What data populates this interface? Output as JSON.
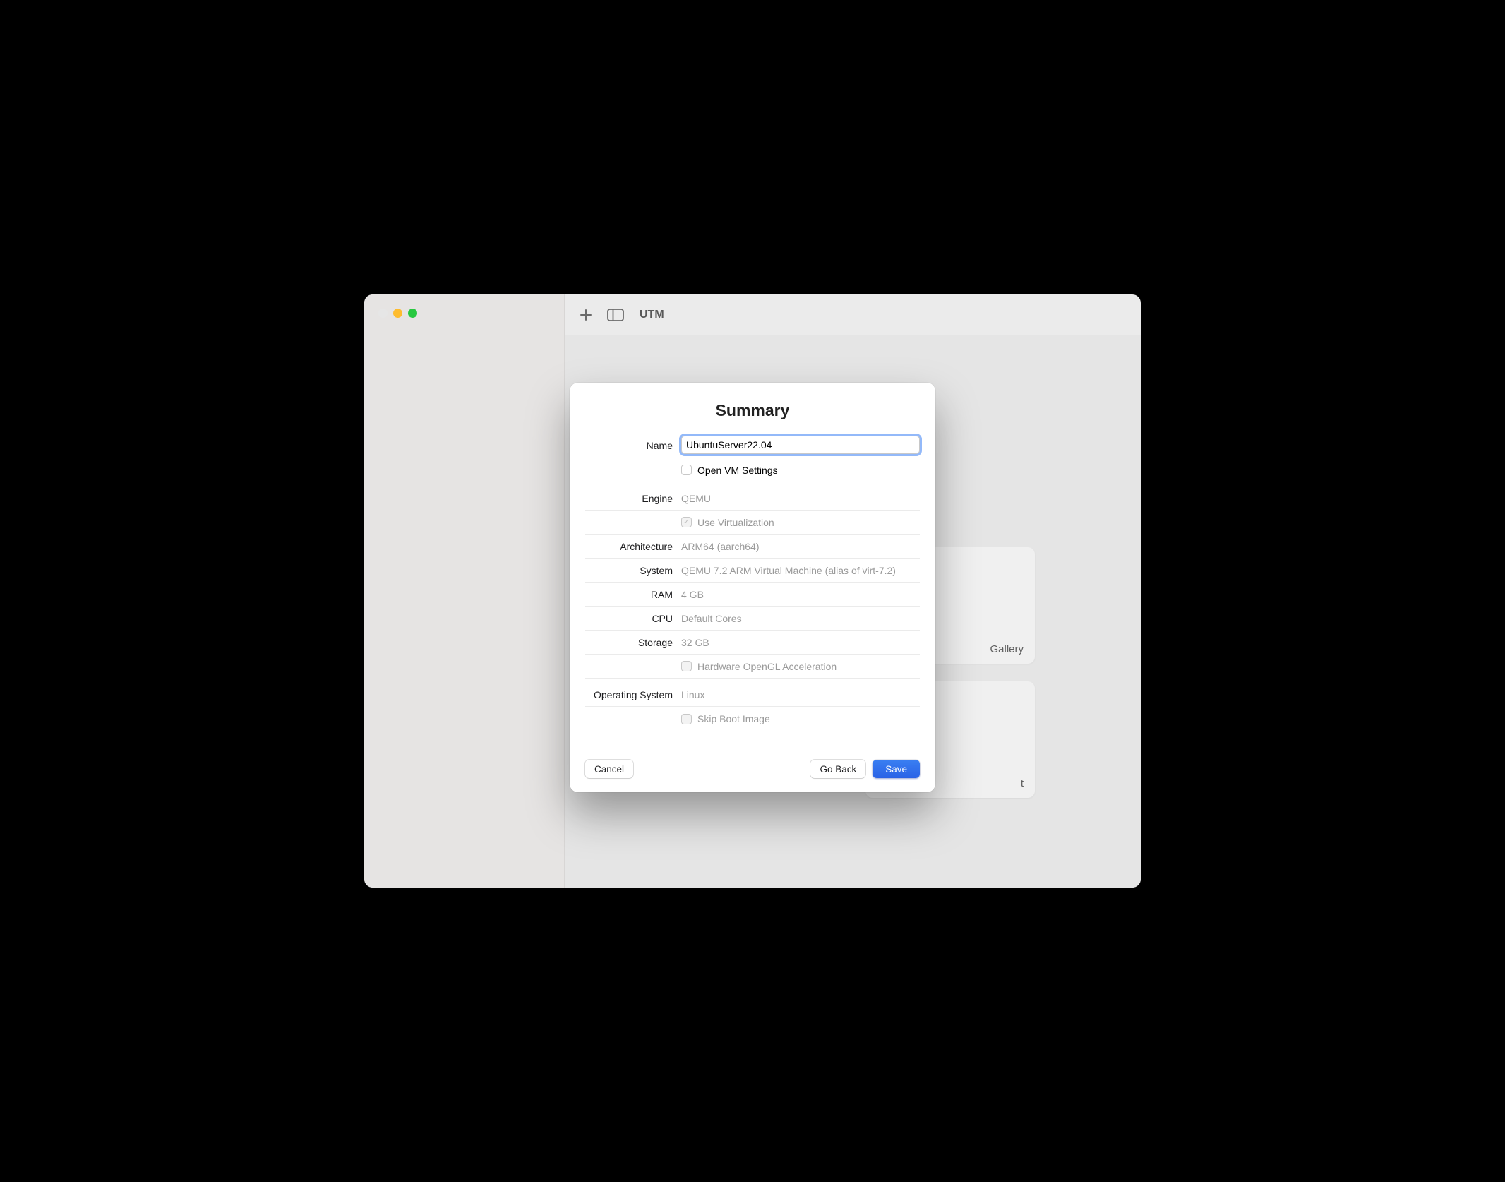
{
  "app": {
    "title": "UTM"
  },
  "background": {
    "card1_label": "Gallery",
    "card2_label": "t"
  },
  "modal": {
    "title": "Summary",
    "fields": {
      "name_label": "Name",
      "name_value": "UbuntuServer22.04",
      "open_settings_label": "Open VM Settings",
      "open_settings_checked": false,
      "engine_label": "Engine",
      "engine_value": "QEMU",
      "virt_label": "Use Virtualization",
      "virt_checked": true,
      "arch_label": "Architecture",
      "arch_value": "ARM64 (aarch64)",
      "system_label": "System",
      "system_value": "QEMU 7.2 ARM Virtual Machine (alias of virt-7.2)",
      "ram_label": "RAM",
      "ram_value": "4 GB",
      "cpu_label": "CPU",
      "cpu_value": "Default Cores",
      "storage_label": "Storage",
      "storage_value": "32 GB",
      "opengl_label": "Hardware OpenGL Acceleration",
      "opengl_checked": false,
      "os_label": "Operating System",
      "os_value": "Linux",
      "skipboot_label": "Skip Boot Image",
      "skipboot_checked": false
    },
    "buttons": {
      "cancel": "Cancel",
      "goback": "Go Back",
      "save": "Save"
    }
  }
}
